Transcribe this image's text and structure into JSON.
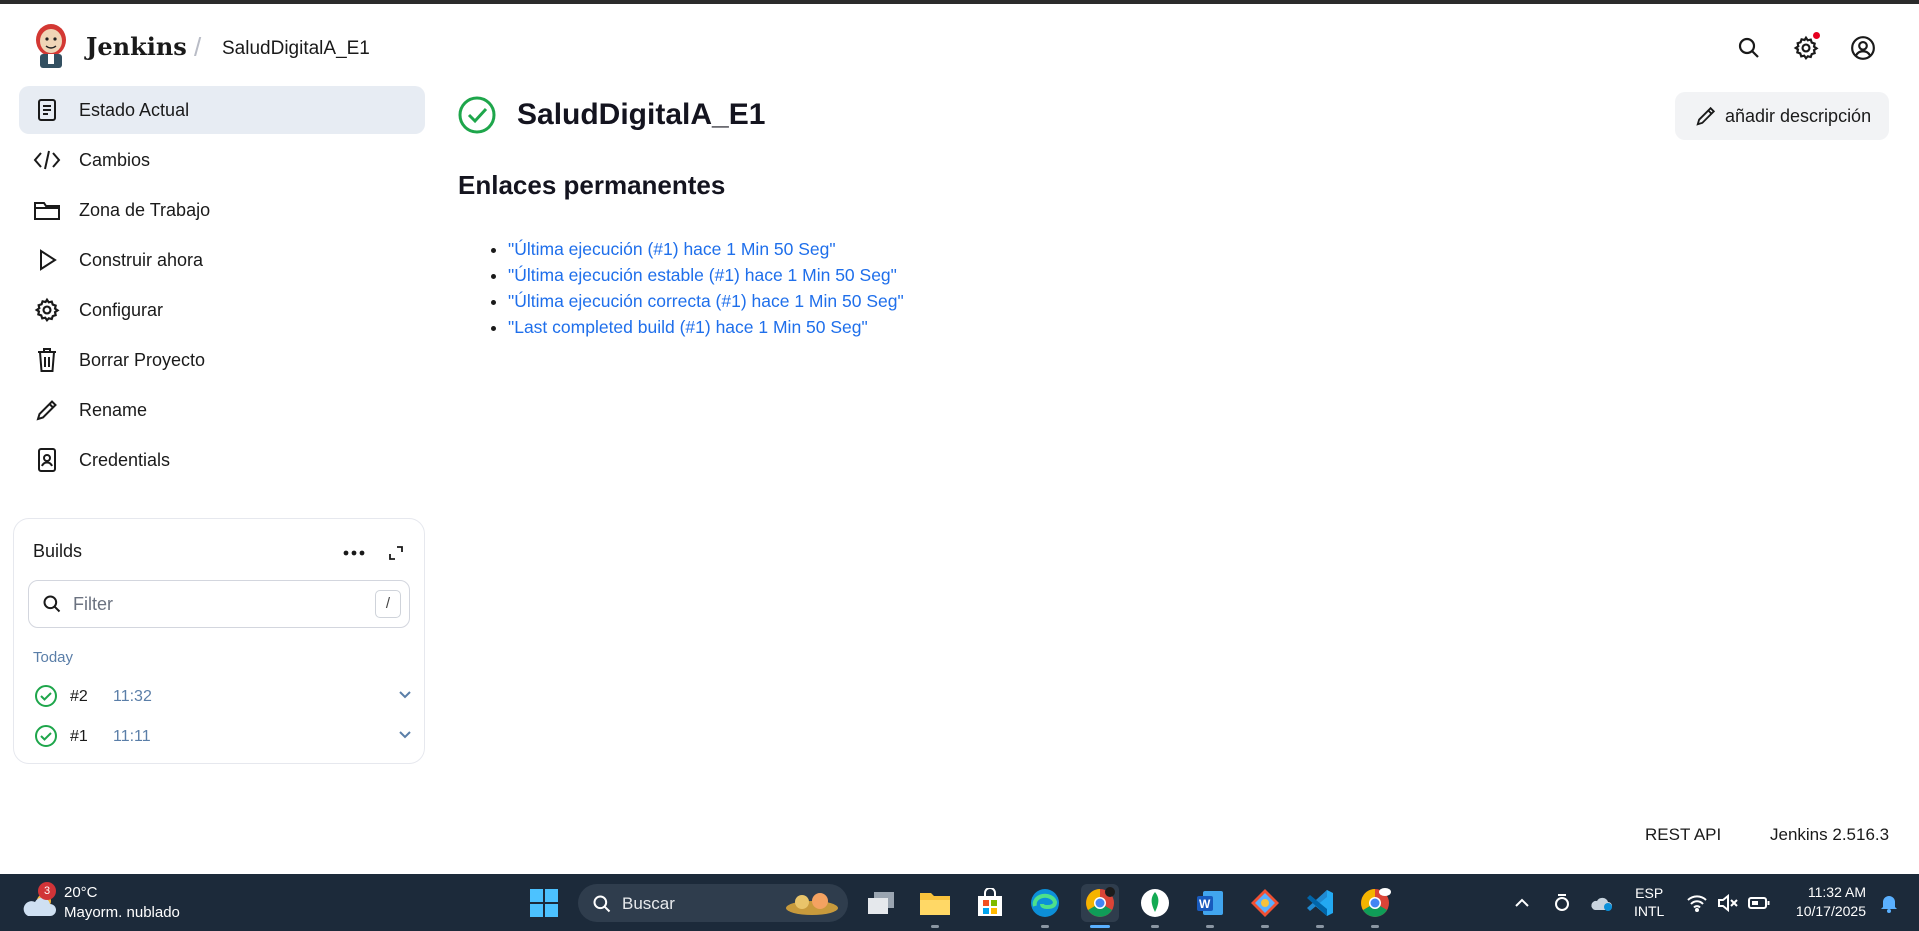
{
  "header": {
    "brand": "Jenkins",
    "separator": "/",
    "breadcrumb": "SaludDigitalA_E1"
  },
  "sidebar": {
    "items": [
      {
        "label": "Estado Actual",
        "icon": "document-icon"
      },
      {
        "label": "Cambios",
        "icon": "code-icon"
      },
      {
        "label": "Zona de Trabajo",
        "icon": "folder-icon"
      },
      {
        "label": "Construir ahora",
        "icon": "play-icon"
      },
      {
        "label": "Configurar",
        "icon": "gear-icon"
      },
      {
        "label": "Borrar Proyecto",
        "icon": "trash-icon"
      },
      {
        "label": "Rename",
        "icon": "pencil-icon"
      },
      {
        "label": "Credentials",
        "icon": "credentials-icon"
      }
    ]
  },
  "builds": {
    "title": "Builds",
    "filter_placeholder": "Filter",
    "shortcut": "/",
    "group": "Today",
    "rows": [
      {
        "number": "#2",
        "time": "11:32",
        "status": "success"
      },
      {
        "number": "#1",
        "time": "11:11",
        "status": "success"
      }
    ]
  },
  "main": {
    "title": "SaludDigitalA_E1",
    "status": "success",
    "add_description": "añadir descripción",
    "section_title": "Enlaces permanentes",
    "links": [
      "\"Última ejecución (#1) hace 1 Min 50 Seg\"",
      "\"Última ejecución estable (#1) hace 1 Min 50 Seg\"",
      "\"Última ejecución correcta (#1) hace 1 Min 50 Seg\"",
      "\"Last completed build (#1) hace 1 Min 50 Seg\""
    ]
  },
  "footer": {
    "rest_api": "REST API",
    "version": "Jenkins 2.516.3"
  },
  "taskbar": {
    "weather_badge": "3",
    "temperature": "20°C",
    "condition": "Mayorm. nublado",
    "search_label": "Buscar",
    "lang_top": "ESP",
    "lang_bottom": "INTL",
    "time": "11:32 AM",
    "date": "10/17/2025"
  },
  "colors": {
    "success": "#1ea64b",
    "link": "#1f6feb",
    "active_bg": "#e7ecf3",
    "taskbar": "#1c2a3a"
  }
}
